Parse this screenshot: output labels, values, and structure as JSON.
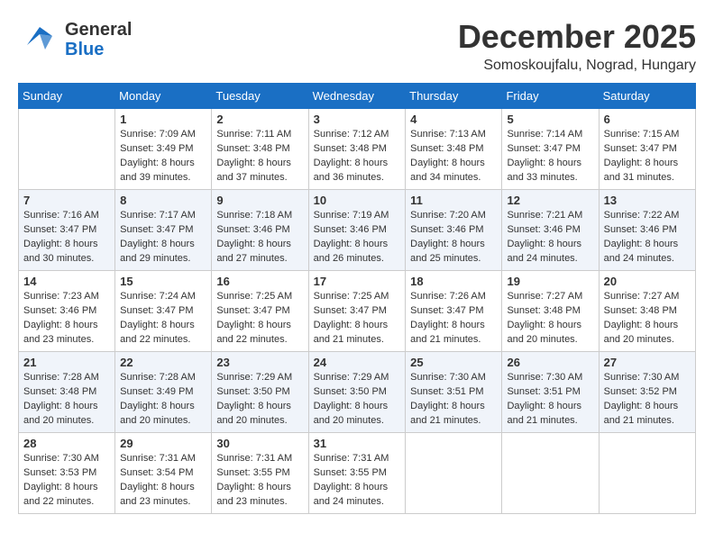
{
  "logo": {
    "general": "General",
    "blue": "Blue"
  },
  "title": {
    "month": "December 2025",
    "location": "Somoskoujfalu, Nograd, Hungary"
  },
  "days_of_week": [
    "Sunday",
    "Monday",
    "Tuesday",
    "Wednesday",
    "Thursday",
    "Friday",
    "Saturday"
  ],
  "weeks": [
    [
      {
        "day": "",
        "sunrise": "",
        "sunset": "",
        "daylight": ""
      },
      {
        "day": "1",
        "sunrise": "Sunrise: 7:09 AM",
        "sunset": "Sunset: 3:49 PM",
        "daylight": "Daylight: 8 hours and 39 minutes."
      },
      {
        "day": "2",
        "sunrise": "Sunrise: 7:11 AM",
        "sunset": "Sunset: 3:48 PM",
        "daylight": "Daylight: 8 hours and 37 minutes."
      },
      {
        "day": "3",
        "sunrise": "Sunrise: 7:12 AM",
        "sunset": "Sunset: 3:48 PM",
        "daylight": "Daylight: 8 hours and 36 minutes."
      },
      {
        "day": "4",
        "sunrise": "Sunrise: 7:13 AM",
        "sunset": "Sunset: 3:48 PM",
        "daylight": "Daylight: 8 hours and 34 minutes."
      },
      {
        "day": "5",
        "sunrise": "Sunrise: 7:14 AM",
        "sunset": "Sunset: 3:47 PM",
        "daylight": "Daylight: 8 hours and 33 minutes."
      },
      {
        "day": "6",
        "sunrise": "Sunrise: 7:15 AM",
        "sunset": "Sunset: 3:47 PM",
        "daylight": "Daylight: 8 hours and 31 minutes."
      }
    ],
    [
      {
        "day": "7",
        "sunrise": "Sunrise: 7:16 AM",
        "sunset": "Sunset: 3:47 PM",
        "daylight": "Daylight: 8 hours and 30 minutes."
      },
      {
        "day": "8",
        "sunrise": "Sunrise: 7:17 AM",
        "sunset": "Sunset: 3:47 PM",
        "daylight": "Daylight: 8 hours and 29 minutes."
      },
      {
        "day": "9",
        "sunrise": "Sunrise: 7:18 AM",
        "sunset": "Sunset: 3:46 PM",
        "daylight": "Daylight: 8 hours and 27 minutes."
      },
      {
        "day": "10",
        "sunrise": "Sunrise: 7:19 AM",
        "sunset": "Sunset: 3:46 PM",
        "daylight": "Daylight: 8 hours and 26 minutes."
      },
      {
        "day": "11",
        "sunrise": "Sunrise: 7:20 AM",
        "sunset": "Sunset: 3:46 PM",
        "daylight": "Daylight: 8 hours and 25 minutes."
      },
      {
        "day": "12",
        "sunrise": "Sunrise: 7:21 AM",
        "sunset": "Sunset: 3:46 PM",
        "daylight": "Daylight: 8 hours and 24 minutes."
      },
      {
        "day": "13",
        "sunrise": "Sunrise: 7:22 AM",
        "sunset": "Sunset: 3:46 PM",
        "daylight": "Daylight: 8 hours and 24 minutes."
      }
    ],
    [
      {
        "day": "14",
        "sunrise": "Sunrise: 7:23 AM",
        "sunset": "Sunset: 3:46 PM",
        "daylight": "Daylight: 8 hours and 23 minutes."
      },
      {
        "day": "15",
        "sunrise": "Sunrise: 7:24 AM",
        "sunset": "Sunset: 3:47 PM",
        "daylight": "Daylight: 8 hours and 22 minutes."
      },
      {
        "day": "16",
        "sunrise": "Sunrise: 7:25 AM",
        "sunset": "Sunset: 3:47 PM",
        "daylight": "Daylight: 8 hours and 22 minutes."
      },
      {
        "day": "17",
        "sunrise": "Sunrise: 7:25 AM",
        "sunset": "Sunset: 3:47 PM",
        "daylight": "Daylight: 8 hours and 21 minutes."
      },
      {
        "day": "18",
        "sunrise": "Sunrise: 7:26 AM",
        "sunset": "Sunset: 3:47 PM",
        "daylight": "Daylight: 8 hours and 21 minutes."
      },
      {
        "day": "19",
        "sunrise": "Sunrise: 7:27 AM",
        "sunset": "Sunset: 3:48 PM",
        "daylight": "Daylight: 8 hours and 20 minutes."
      },
      {
        "day": "20",
        "sunrise": "Sunrise: 7:27 AM",
        "sunset": "Sunset: 3:48 PM",
        "daylight": "Daylight: 8 hours and 20 minutes."
      }
    ],
    [
      {
        "day": "21",
        "sunrise": "Sunrise: 7:28 AM",
        "sunset": "Sunset: 3:48 PM",
        "daylight": "Daylight: 8 hours and 20 minutes."
      },
      {
        "day": "22",
        "sunrise": "Sunrise: 7:28 AM",
        "sunset": "Sunset: 3:49 PM",
        "daylight": "Daylight: 8 hours and 20 minutes."
      },
      {
        "day": "23",
        "sunrise": "Sunrise: 7:29 AM",
        "sunset": "Sunset: 3:50 PM",
        "daylight": "Daylight: 8 hours and 20 minutes."
      },
      {
        "day": "24",
        "sunrise": "Sunrise: 7:29 AM",
        "sunset": "Sunset: 3:50 PM",
        "daylight": "Daylight: 8 hours and 20 minutes."
      },
      {
        "day": "25",
        "sunrise": "Sunrise: 7:30 AM",
        "sunset": "Sunset: 3:51 PM",
        "daylight": "Daylight: 8 hours and 21 minutes."
      },
      {
        "day": "26",
        "sunrise": "Sunrise: 7:30 AM",
        "sunset": "Sunset: 3:51 PM",
        "daylight": "Daylight: 8 hours and 21 minutes."
      },
      {
        "day": "27",
        "sunrise": "Sunrise: 7:30 AM",
        "sunset": "Sunset: 3:52 PM",
        "daylight": "Daylight: 8 hours and 21 minutes."
      }
    ],
    [
      {
        "day": "28",
        "sunrise": "Sunrise: 7:30 AM",
        "sunset": "Sunset: 3:53 PM",
        "daylight": "Daylight: 8 hours and 22 minutes."
      },
      {
        "day": "29",
        "sunrise": "Sunrise: 7:31 AM",
        "sunset": "Sunset: 3:54 PM",
        "daylight": "Daylight: 8 hours and 23 minutes."
      },
      {
        "day": "30",
        "sunrise": "Sunrise: 7:31 AM",
        "sunset": "Sunset: 3:55 PM",
        "daylight": "Daylight: 8 hours and 23 minutes."
      },
      {
        "day": "31",
        "sunrise": "Sunrise: 7:31 AM",
        "sunset": "Sunset: 3:55 PM",
        "daylight": "Daylight: 8 hours and 24 minutes."
      },
      {
        "day": "",
        "sunrise": "",
        "sunset": "",
        "daylight": ""
      },
      {
        "day": "",
        "sunrise": "",
        "sunset": "",
        "daylight": ""
      },
      {
        "day": "",
        "sunrise": "",
        "sunset": "",
        "daylight": ""
      }
    ]
  ]
}
